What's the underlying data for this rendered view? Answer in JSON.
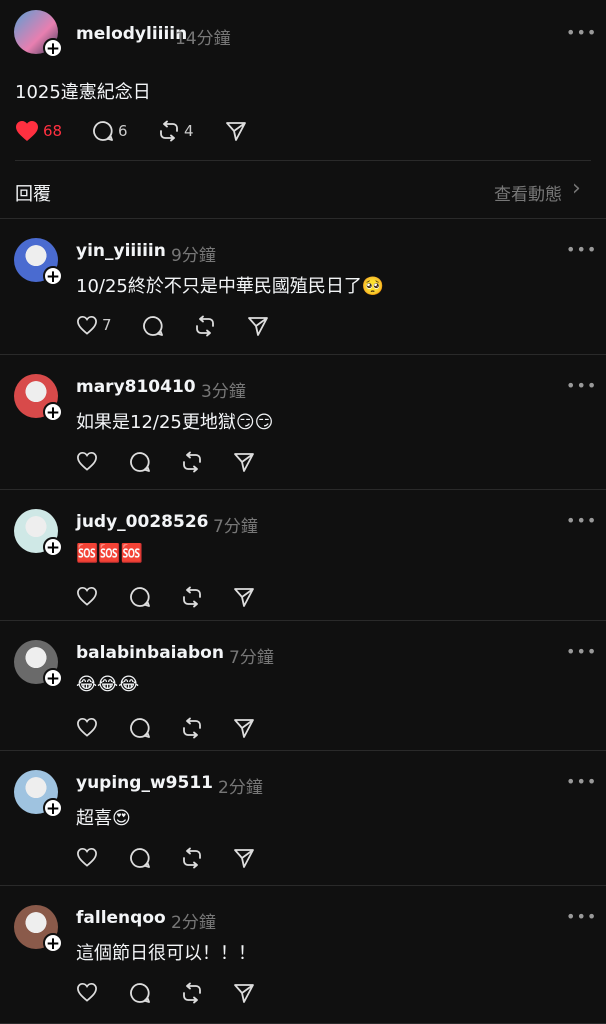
{
  "post": {
    "username": "melodyliiiin",
    "time": "14分鐘",
    "text": "1025違憲紀念日",
    "likes": "68",
    "comments": "6",
    "reposts": "4",
    "more": "•••"
  },
  "section": {
    "title": "回覆",
    "view_activity": "查看動態",
    "chevron": "›"
  },
  "replies": [
    {
      "username": "yin_yiiiiin",
      "time": "9分鐘",
      "text": "10/25終於不只是中華民國殖民日了🥺",
      "likes": "7",
      "avatar_color": "#4a6bd0"
    },
    {
      "username": "mary810410",
      "time": "3分鐘",
      "text": "如果是12/25更地獄😏😏",
      "likes": "",
      "avatar_color": "#d84a4a"
    },
    {
      "username": "judy_0028526",
      "time": "7分鐘",
      "text": "🆘🆘🆘",
      "likes": "",
      "avatar_color": "#cfe8e6"
    },
    {
      "username": "balabinbaiabon",
      "time": "7分鐘",
      "text": "😂😂😂",
      "likes": "",
      "avatar_color": "#6a6a6a"
    },
    {
      "username": "yuping_w9511",
      "time": "2分鐘",
      "text": "超喜😍",
      "likes": "",
      "avatar_color": "#9fc3e0"
    },
    {
      "username": "fallenqoo",
      "time": "2分鐘",
      "text": "這個節日很可以！！！",
      "likes": "",
      "avatar_color": "#8a5a4a"
    }
  ],
  "colors": {
    "background": "#101010",
    "like_active": "#ff3040",
    "muted": "#777777"
  }
}
